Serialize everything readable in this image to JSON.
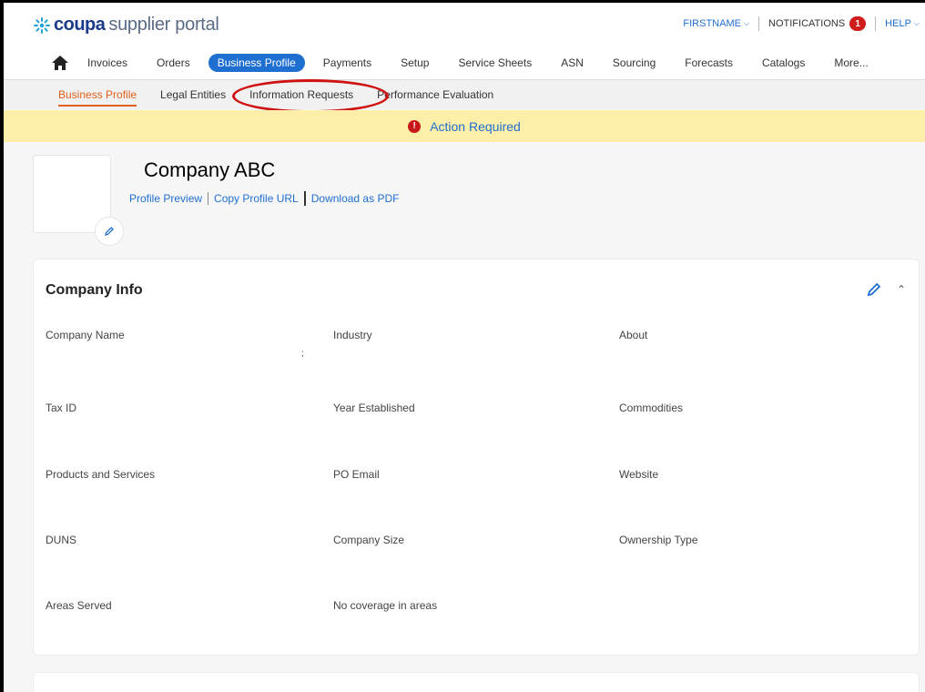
{
  "brand": {
    "logo_word": "coupa",
    "logo_rest": "supplier portal",
    "colors": {
      "accent": "#1f6fd1",
      "brand": "#1a3a8c",
      "active_sub": "#e0601c",
      "banner": "#fdeea9",
      "alert": "#c81818"
    }
  },
  "topbar": {
    "user": "FIRSTNAME",
    "notifications_label": "NOTIFICATIONS",
    "notifications_count": "1",
    "help": "HELP"
  },
  "main_nav": {
    "home_icon": "home-icon",
    "items": [
      "Invoices",
      "Orders",
      "Business Profile",
      "Payments",
      "Setup",
      "Service Sheets",
      "ASN",
      "Sourcing",
      "Forecasts",
      "Catalogs",
      "More..."
    ],
    "active": "Business Profile"
  },
  "sub_nav": {
    "items": [
      "Business Profile",
      "Legal Entities",
      "Information Requests",
      "Performance Evaluation"
    ],
    "active": "Business Profile"
  },
  "banner": {
    "text": "Action Required",
    "icon": "alert-icon",
    "icon_glyph": "!"
  },
  "profile": {
    "company_name": "Company ABC",
    "links": [
      "Profile Preview",
      "Copy Profile URL",
      "Download as PDF"
    ]
  },
  "company_info": {
    "title": "Company Info",
    "stray_mark": ";",
    "fields": {
      "company_name": "Company Name",
      "industry": "Industry",
      "about": "About",
      "tax_id": "Tax ID",
      "year_established": "Year Established",
      "commodities": "Commodities",
      "products_services": "Products and Services",
      "po_email": "PO Email",
      "website": "Website",
      "duns": "DUNS",
      "company_size": "Company Size",
      "ownership_type": "Ownership Type",
      "areas_served": "Areas Served",
      "areas_value": "No coverage in areas"
    }
  }
}
